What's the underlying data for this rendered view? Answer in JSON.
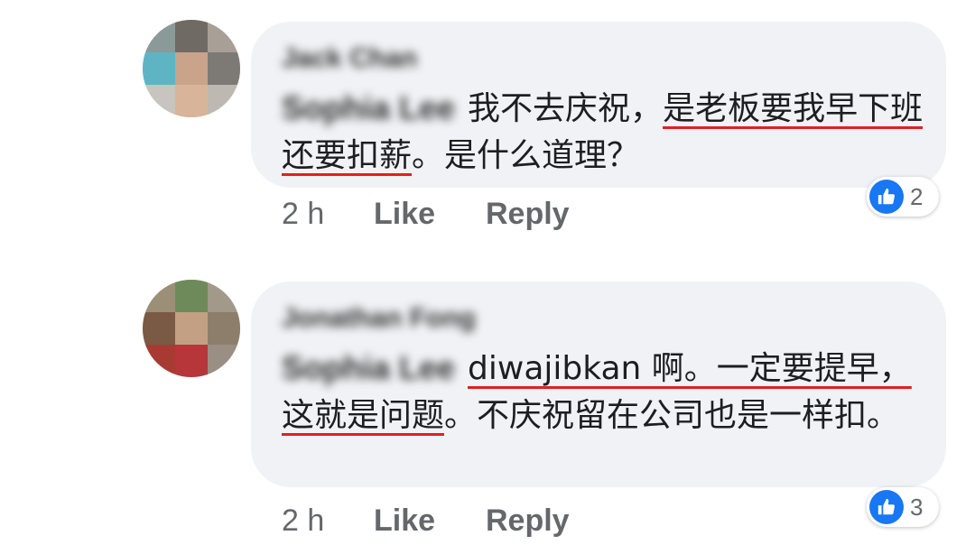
{
  "comments": [
    {
      "author": "Jack Chan",
      "mention": "Sophia Lee",
      "text_plain_1": "我不去庆祝，",
      "text_ul_1": "是老板要我早下班还要扣薪",
      "text_plain_2": "。是什么道理？",
      "time": "2 h",
      "like_label": "Like",
      "reply_label": "Reply",
      "reaction_icon": "thumbs-up-icon",
      "reaction_count": "2"
    },
    {
      "author": "Jonathan Fong",
      "mention": "Sophia Lee",
      "text_ul_1": "diwajibkan 啊。一定要提早，这就是问题",
      "text_plain_1": "。不庆祝留在公司也是一样扣。",
      "time": "2 h",
      "like_label": "Like",
      "reply_label": "Reply",
      "reaction_icon": "thumbs-up-icon",
      "reaction_count": "3"
    }
  ],
  "colors": {
    "bubble": "#f0f2f5",
    "secondary_text": "#65676b",
    "like_blue": "#1877f2",
    "underline_red": "#e02020"
  }
}
